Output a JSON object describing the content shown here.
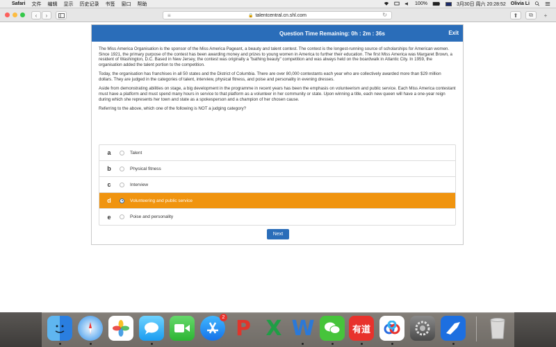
{
  "menubar": {
    "apple": "",
    "app": "Safari",
    "menus": [
      "文件",
      "编辑",
      "显示",
      "历史记录",
      "书签",
      "窗口",
      "帮助"
    ],
    "battery": "100%",
    "datetime": "3月30日 周六  20:28:52",
    "user": "Olivia Li"
  },
  "browser": {
    "url": "talentcentral.cn.shl.com",
    "back": "‹",
    "forward": "›",
    "reader_icon": "≡",
    "reload_icon": "↻",
    "share_icon": "⬆",
    "tabs_icon": "⧉"
  },
  "test": {
    "timer": "Question Time Remaining: 0h : 2m : 36s",
    "exit": "Exit",
    "paragraphs": [
      "The Miss America Organisation is the sponsor of the Miss America Pageant, a beauty and talent contest. The contest is the longest-running source of scholarships for American women. Since 1921, the primary purpose of the contest has been awarding money and prizes to young women in America to further their education. The first Miss America was Margaret Brown, a resident of Washington, D.C. Based in New Jersey, the contest was originally a \"bathing beauty\" competition and was always held on the boardwalk in Atlantic City. In 1959, the organisation added the talent portion to the competition.",
      "Today, the organisation has franchises in all 50 states and the District of Columbia. There are over 80,000 contestants each year who are collectively awarded more than $29 million dollars. They are judged in the categories of talent, interview, physical fitness, and poise and personality in evening dresses.",
      "Aside from demonstrating abilities on stage, a big development in the programme in recent years has been the emphasis on volunteerism and public service. Each Miss America contestant must have a platform and must spend many hours in service to that platform as a volunteer in her community or state. Upon winning a title, each new queen will have a one-year reign during which she represents her town and state as a spokesperson and a champion of her chosen cause."
    ],
    "question": "Referring to the above, which one of the following is NOT a judging category?",
    "options": [
      {
        "letter": "a",
        "label": "Talent",
        "selected": false
      },
      {
        "letter": "b",
        "label": "Physical fitness",
        "selected": false
      },
      {
        "letter": "c",
        "label": "Interview",
        "selected": false
      },
      {
        "letter": "d",
        "label": "Volunteering and public service",
        "selected": true
      },
      {
        "letter": "e",
        "label": "Poise and personality",
        "selected": false
      }
    ],
    "next": "Next"
  },
  "dock": {
    "appstore_badge": "2",
    "icons": [
      "finder-icon",
      "safari-icon",
      "photos-icon",
      "messages-icon",
      "facetime-icon",
      "app-store-icon",
      "powerpoint-icon",
      "excel-icon",
      "word-icon",
      "wechat-icon",
      "youdao-icon",
      "baidu-netdisk-icon",
      "system-preferences-icon",
      "lark-icon",
      "trash-icon"
    ],
    "youdao_label": "有道"
  },
  "colors": {
    "header_blue": "#2a6db9",
    "selected_orange": "#f0940f"
  }
}
